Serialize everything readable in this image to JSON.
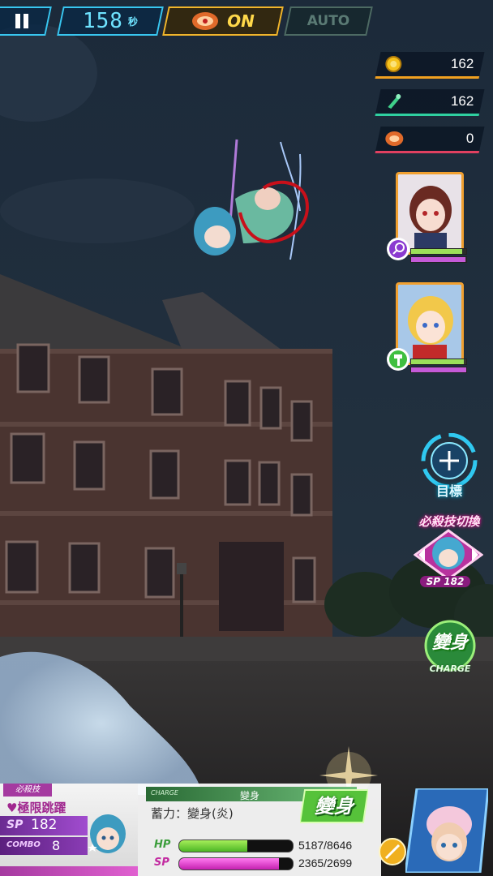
{
  "hud": {
    "timer_value": "158",
    "timer_unit": "秒",
    "burst_state": "ON",
    "auto_label": "AUTO"
  },
  "resources": [
    {
      "icon": "gold-coin-icon",
      "value": "162",
      "accent": "#f0a020"
    },
    {
      "icon": "green-crystal-icon",
      "value": "162",
      "accent": "#2fd0a0"
    },
    {
      "icon": "ticket-badge-icon",
      "value": "0",
      "accent": "#e04060"
    }
  ],
  "right_buttons": {
    "target_label": "目標",
    "ultimate_switch_title": "必殺技切換",
    "ultimate_sp": "SP 182",
    "transform_label": "變身",
    "charge_label": "CHARGE"
  },
  "skill_panel": {
    "tag": "必殺技",
    "skill_name": "♥極限跳躍",
    "sp_label": "SP",
    "sp_value": "182",
    "combo_label": "COMBO",
    "combo_value": "8"
  },
  "transform_panel": {
    "charge_tag": "CHARGE",
    "title": "變身",
    "accumulate_text": "蓄力：變身(炎)",
    "button_label": "變身"
  },
  "status": {
    "hp_label": "HP",
    "hp_text": "5187/8646",
    "hp_current": 5187,
    "hp_max": 8646,
    "sp_label": "SP",
    "sp_text": "2365/2699",
    "sp_current": 2365,
    "sp_max": 2699
  },
  "colors": {
    "hud_cyan": "#38c6f0",
    "burst_gold": "#f1b52b",
    "hp_green": "#6fd23a",
    "sp_magenta": "#e030d0",
    "card_border": "#f0a030"
  }
}
